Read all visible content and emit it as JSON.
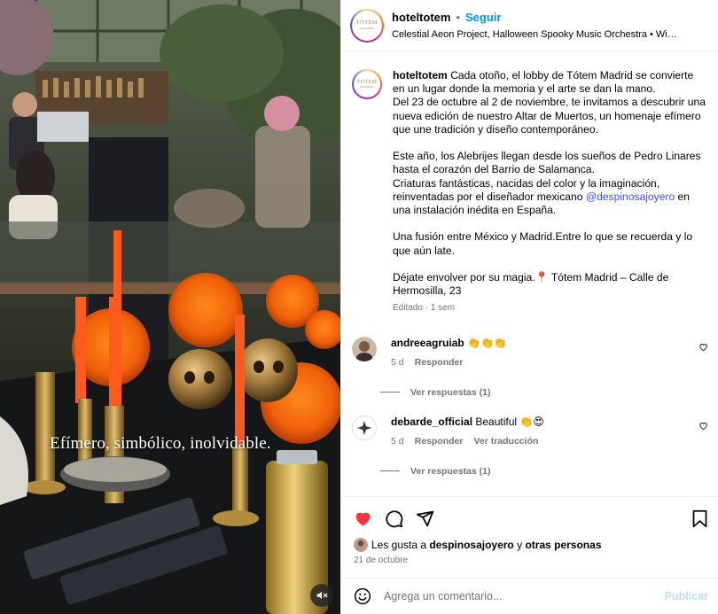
{
  "media": {
    "overlay_caption": "Efímero, simbólico, inolvidable.",
    "mute_icon": "speaker-muted-icon"
  },
  "post": {
    "account": {
      "username": "hoteltotem",
      "follow_label": "Seguir",
      "separator": "•",
      "logo_text": "TÓTEM",
      "logo_subtext": "MADRID"
    },
    "audio": "Celestial Aeon Project, Halloween Spooky Music Orchestra • Wi…",
    "caption": {
      "username": "hoteltotem",
      "intro": "Cada otoño, el lobby de Tótem Madrid se convierte en un lugar donde la memoria y el arte se dan la mano.\nDel 23 de octubre al 2 de noviembre, te invitamos a descubrir una nueva edición de nuestro Altar de Muertos, un homenaje efímero que une tradición y diseño contemporáneo.\n\nEste año, los Alebrijes llegan desde los sueños de Pedro Linares hasta el corazón del Barrio de Salamanca.\nCriaturas fantásticas, nacidas del color y la imaginación, reinventadas por el diseñador mexicano ",
      "mention": "@despinosajoyero",
      "after_mention": " en una instalación inédita en España.\n\nUna fusión entre México y Madrid.Entre lo que se recuerda y lo que aún late.\n\nDéjate envolver por su magia.",
      "pin": "📍",
      "location": " Tótem Madrid – Calle de Hermosilla, 23"
    },
    "caption_meta": "Editado · 1 sem"
  },
  "comments": [
    {
      "username": "andreeagruiab",
      "text": "👏👏👏",
      "age": "5 d",
      "reply_label": "Responder",
      "translate_label": "",
      "view_replies": "Ver respuestas (1)"
    },
    {
      "username": "debarde_official",
      "text": "Beautiful 👏😍",
      "age": "5 d",
      "reply_label": "Responder",
      "translate_label": "Ver traducción",
      "view_replies": "Ver respuestas (1)"
    }
  ],
  "actions": {
    "likes_prefix": "Les gusta a ",
    "likes_user": "despinosajoyero",
    "likes_connector": " y ",
    "likes_others": "otras personas",
    "date": "21 de octubre",
    "liked": true,
    "like_color": "#ff3040"
  },
  "comment_box": {
    "placeholder": "Agrega un comentario...",
    "publish_label": "Publicar"
  },
  "colors": {
    "link_blue": "#0095f6",
    "mention": "#4150f7",
    "publish_disabled": "#b2dffc",
    "secondary_text": "#737373"
  }
}
